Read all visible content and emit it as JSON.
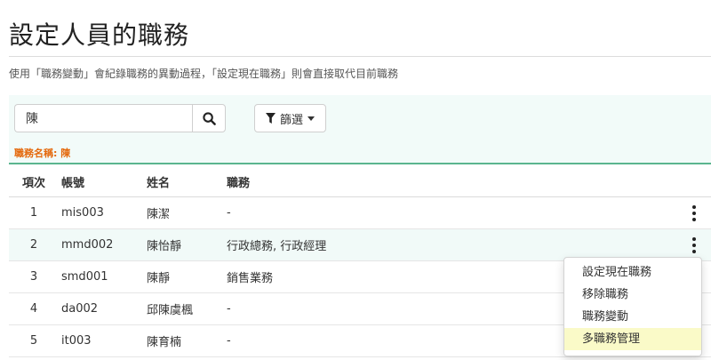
{
  "page": {
    "title": "設定人員的職務",
    "description": "使用「職務變動」會紀錄職務的異動過程，「設定現在職務」則會直接取代目前職務"
  },
  "filter": {
    "search_value": "陳",
    "search_placeholder": "",
    "filter_button_label": "篩選",
    "active_filter_label": "職務名稱: 陳"
  },
  "table": {
    "headers": {
      "no": "項次",
      "account": "帳號",
      "name": "姓名",
      "duty": "職務"
    },
    "rows": [
      {
        "no": "1",
        "account": "mis003",
        "name": "陳潔",
        "duty": "-"
      },
      {
        "no": "2",
        "account": "mmd002",
        "name": "陳怡靜",
        "duty": "行政總務, 行政經理"
      },
      {
        "no": "3",
        "account": "smd001",
        "name": "陳靜",
        "duty": "銷售業務"
      },
      {
        "no": "4",
        "account": "da002",
        "name": "邱陳虞楓",
        "duty": "-"
      },
      {
        "no": "5",
        "account": "it003",
        "name": "陳育楠",
        "duty": "-"
      }
    ]
  },
  "row_menu": {
    "items": [
      "設定現在職務",
      "移除職務",
      "職務變動",
      "多職務管理"
    ],
    "highlighted": "多職務管理"
  },
  "colors": {
    "accent_green": "#5ab58f",
    "filter_panel_bg": "#f2fbf9",
    "filter_label_orange": "#e4690c",
    "menu_highlight": "#fafac8"
  },
  "icons": {
    "search": "search-icon",
    "filter": "funnel-icon",
    "row_actions": "kebab-menu-icon"
  }
}
